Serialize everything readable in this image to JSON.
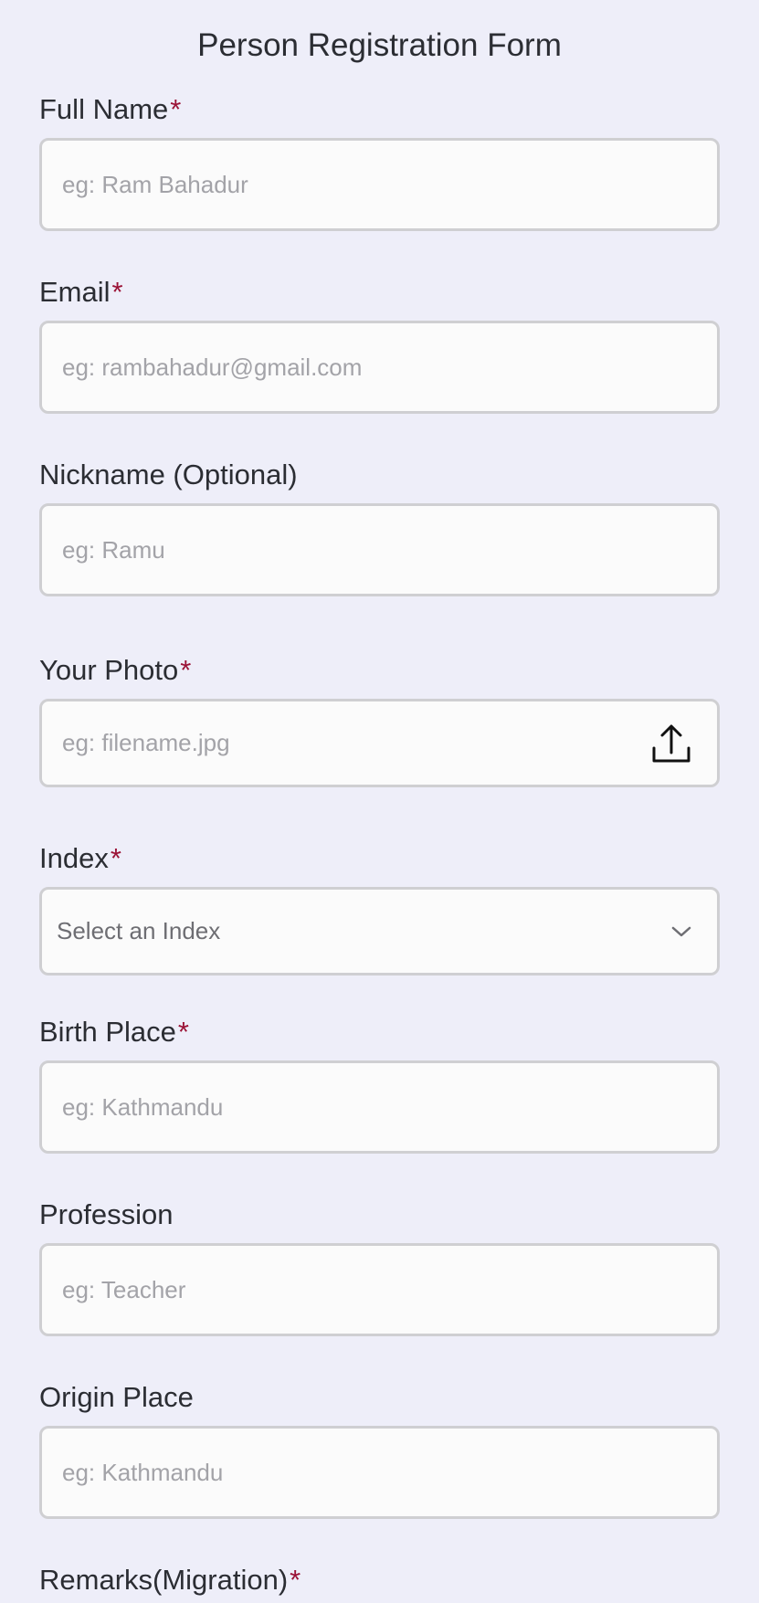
{
  "form": {
    "title": "Person Registration Form",
    "required_marker": "*",
    "full_name": {
      "label": "Full Name",
      "placeholder": "eg: Ram Bahadur"
    },
    "email": {
      "label": "Email",
      "placeholder": "eg: rambahadur@gmail.com"
    },
    "nickname": {
      "label": "Nickname (Optional)",
      "placeholder": "eg: Ramu"
    },
    "photo": {
      "label": "Your Photo",
      "placeholder": "eg: filename.jpg",
      "icon": "upload-icon"
    },
    "index": {
      "label": "Index",
      "selected": "Select an Index",
      "icon": "chevron-down-icon"
    },
    "birth_place": {
      "label": "Birth Place",
      "placeholder": "eg: Kathmandu"
    },
    "profession": {
      "label": "Profession",
      "placeholder": "eg: Teacher"
    },
    "origin_place": {
      "label": "Origin Place",
      "placeholder": "eg: Kathmandu"
    },
    "remarks": {
      "label": "Remarks(Migration)"
    }
  },
  "colors": {
    "background": "#eeeef9",
    "required": "#9b1236",
    "input_bg": "#fbfbfb",
    "input_border": "#cfcfd2",
    "placeholder": "#a3a3a8"
  }
}
